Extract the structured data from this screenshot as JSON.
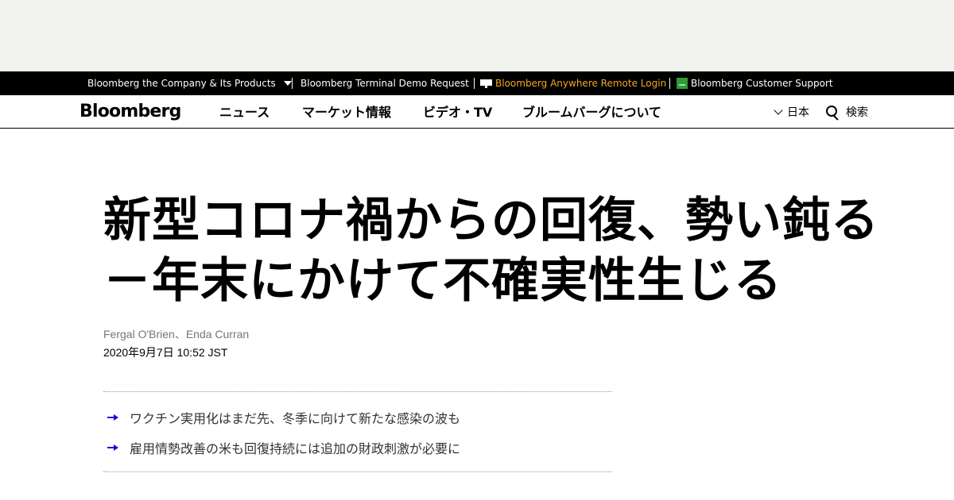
{
  "topbar": {
    "company_label": "Bloomberg the Company & Its Products",
    "terminal_label": "Bloomberg Terminal Demo Request",
    "anywhere_label": "Bloomberg Anywhere Remote Login",
    "support_label": "Bloomberg Customer Support"
  },
  "nav": {
    "logo": "Bloomberg",
    "items": [
      "ニュース",
      "マーケット情報",
      "ビデオ・TV",
      "ブルームバーグについて"
    ],
    "language": "日本",
    "search_label": "検索"
  },
  "article": {
    "headline_line1": "新型コロナ禍からの回復、勢い鈍る",
    "headline_line2": "－年末にかけて不確実性生じる",
    "byline": "Fergal O'Brien、Enda Curran",
    "date": "2020年9月7日 10:52 JST",
    "summary": [
      "ワクチン実用化はまだ先、冬季に向けて新たな感染の波も",
      "雇用情勢改善の米も回復持続には追加の財政刺激が必要に"
    ]
  },
  "colors": {
    "topbar_bg": "#000000",
    "anywhere_accent": "#f5a623",
    "summary_arrow": "#2800d7",
    "ad_bg": "#f2f2ef"
  }
}
